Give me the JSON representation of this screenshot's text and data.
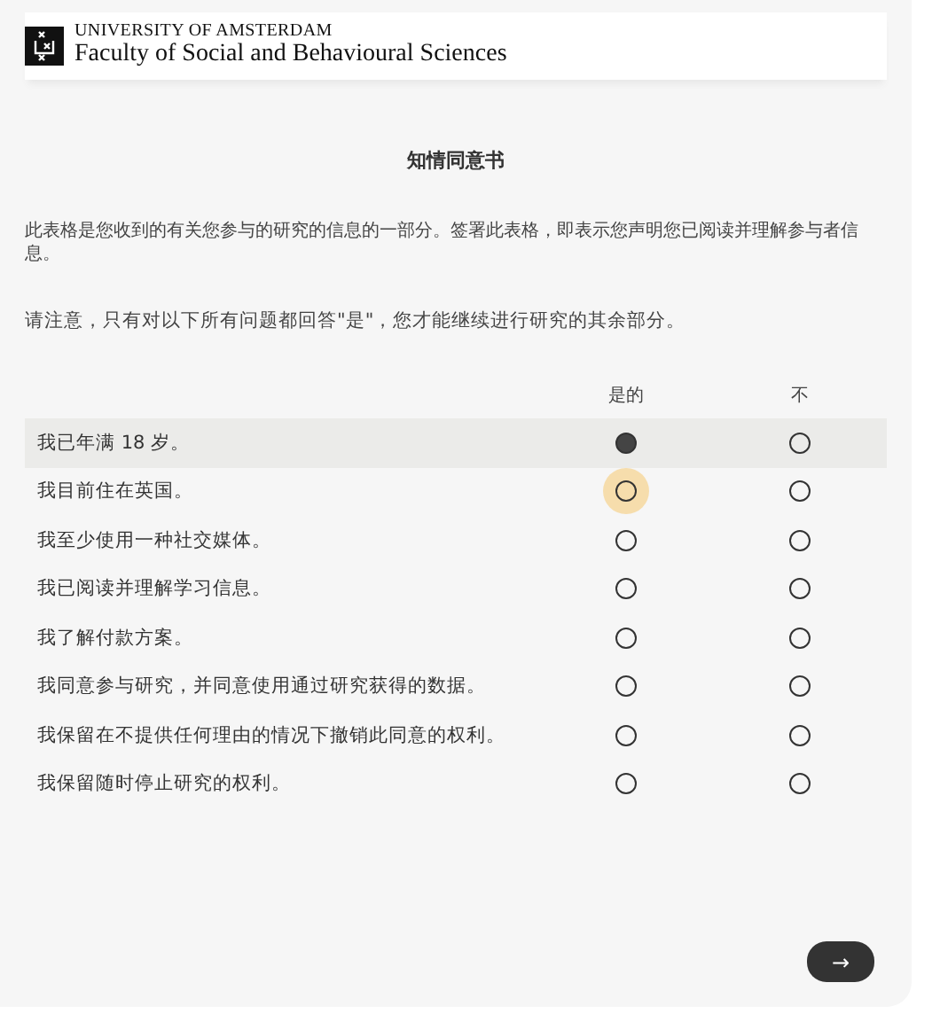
{
  "header": {
    "university": "UNIVERSITY OF AMSTERDAM",
    "faculty": "Faculty of Social and Behavioural Sciences"
  },
  "title": "知情同意书",
  "intro": "此表格是您收到的有关您参与的研究的信息的一部分。签署此表格，即表示您声明您已阅读并理解参与者信息。",
  "note": "请注意，只有对以下所有问题都回答\"是\"，您才能继续进行研究的其余部分。",
  "columns": [
    "是的",
    "不"
  ],
  "rows": [
    {
      "label": "我已年满 18 岁。",
      "highlighted": true,
      "options": [
        {
          "selected": true,
          "focused": false
        },
        {
          "selected": false,
          "focused": false
        }
      ]
    },
    {
      "label": "我目前住在英国。",
      "highlighted": false,
      "options": [
        {
          "selected": false,
          "focused": true
        },
        {
          "selected": false,
          "focused": false
        }
      ]
    },
    {
      "label": "我至少使用一种社交媒体。",
      "highlighted": false,
      "options": [
        {
          "selected": false,
          "focused": false
        },
        {
          "selected": false,
          "focused": false
        }
      ]
    },
    {
      "label": "我已阅读并理解学习信息。",
      "highlighted": false,
      "options": [
        {
          "selected": false,
          "focused": false
        },
        {
          "selected": false,
          "focused": false
        }
      ]
    },
    {
      "label": "我了解付款方案。",
      "highlighted": false,
      "options": [
        {
          "selected": false,
          "focused": false
        },
        {
          "selected": false,
          "focused": false
        }
      ]
    },
    {
      "label": "我同意参与研究，并同意使用通过研究获得的数据。",
      "highlighted": false,
      "options": [
        {
          "selected": false,
          "focused": false
        },
        {
          "selected": false,
          "focused": false
        }
      ]
    },
    {
      "label": "我保留在不提供任何理由的情况下撤销此同意的权利。",
      "highlighted": false,
      "options": [
        {
          "selected": false,
          "focused": false
        },
        {
          "selected": false,
          "focused": false
        }
      ]
    },
    {
      "label": "我保留随时停止研究的权利。",
      "highlighted": false,
      "options": [
        {
          "selected": false,
          "focused": false
        },
        {
          "selected": false,
          "focused": false
        }
      ]
    }
  ],
  "next_button": "→"
}
